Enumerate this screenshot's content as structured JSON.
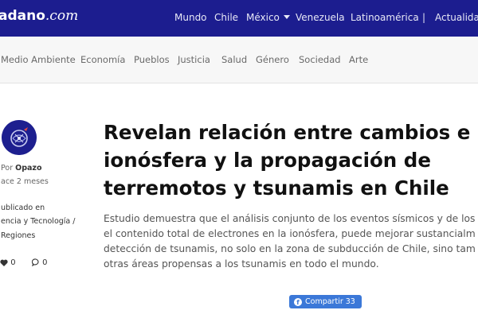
{
  "header": {
    "logo_bold": "adano",
    "logo_italic": ".com",
    "nav": [
      "Mundo",
      "Chile",
      "México",
      "Venezuela",
      "Latinoamérica",
      "|",
      "Actualidad"
    ]
  },
  "subnav": [
    "Medio Ambiente",
    "Economía",
    "Pueblos",
    "Justicia",
    "Salud",
    "Género",
    "Sociedad",
    "Arte"
  ],
  "author": {
    "by_prefix": "Por",
    "name": "Opazo",
    "time": "ace 2 meses",
    "published_label": "ublicado en",
    "category_line1": "encia y Tecnología /",
    "category_line2": "Regiones",
    "likes": "0",
    "comments": "0"
  },
  "article": {
    "title_lines": [
      "Revelan relación entre cambios e",
      "ionósfera y la propagación de",
      "terremotos y tsunamis en Chile"
    ],
    "lead_lines": [
      "Estudio demuestra que el análisis conjunto de los eventos sísmicos y de los",
      "el contenido total de electrones en la ionósfera, puede mejorar sustancialm",
      "detección de tsunamis, no solo en la zona de subducción de Chile, sino tam",
      "otras áreas propensas a los tsunamis en todo el mundo."
    ],
    "share_label": "Compartir 33"
  },
  "colors": {
    "header_bg": "#1c1d8f",
    "share_button": "#3b78d8"
  }
}
